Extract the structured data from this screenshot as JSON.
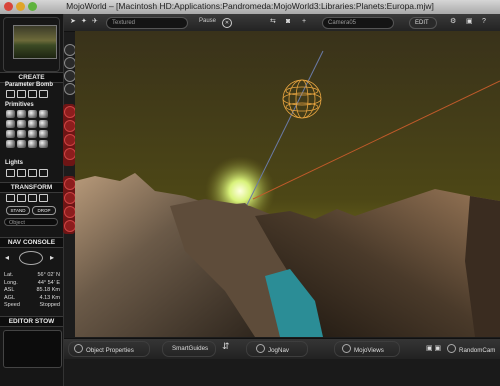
{
  "window": {
    "title": "MojoWorld – [Macintosh HD:Applications:Pandromeda:MojoWorld3:Libraries:Planets:Europa.mjw]"
  },
  "toolbar": {
    "render_mode": "Textured",
    "pause_label": "Pause",
    "camera_select": "Camera05",
    "edit_label": "EDIT"
  },
  "sidebar": {
    "create_title": "CREATE",
    "parameter_bomb_label": "Parameter Bomb",
    "primitives_label": "Primitives",
    "lights_label": "Lights",
    "transform_title": "TRANSFORM",
    "stand_label": "STAND",
    "drop_label": "DROP",
    "object_select": "Object",
    "nav_console_title": "NAV CONSOLE",
    "nav": {
      "lat_label": "Lat.",
      "lat_value": "56° 02' N",
      "long_label": "Long.",
      "long_value": "44° 54' E",
      "asl_label": "ASL",
      "asl_value": "85.18 Km",
      "agl_label": "AGL",
      "agl_value": "4.13 Km",
      "speed_label": "Speed",
      "speed_value": "Stopped"
    },
    "editor_stow_title": "EDITOR STOW"
  },
  "bottom_bar": {
    "object_properties": "Object Properties",
    "smart_guides": "SmartGuides",
    "jog_nav": "JogNav",
    "mojo_views": "MojoViews",
    "random_cam": "RandomCam"
  },
  "colors": {
    "sky_top": "#39321a",
    "sky_horizon": "#6e6a1c",
    "sun_glow": "#d8f27a",
    "water": "#2b8d96",
    "wire_sphere": "#e8a540",
    "close": "#d8453b",
    "minimize": "#e0a52a",
    "zoom": "#5fb33d"
  }
}
